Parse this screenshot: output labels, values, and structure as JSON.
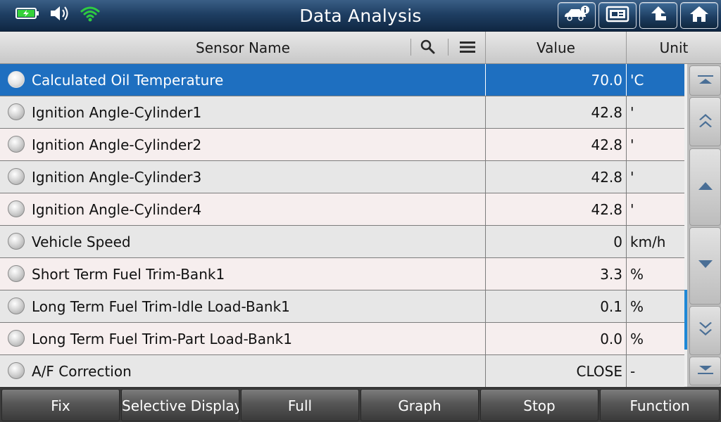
{
  "app": {
    "title": "Data Analysis",
    "status_icons": [
      "battery-charging-icon",
      "speaker-icon",
      "wifi-icon"
    ],
    "top_buttons": [
      "vehicle-info-icon",
      "print-screen-icon",
      "back-up-icon",
      "home-icon"
    ]
  },
  "colors": {
    "selected_row": "#1e6fc0",
    "wifi": "#2ecc40",
    "battery": "#36d13a",
    "scroll_indicator": "#1e88d6"
  },
  "table": {
    "headers": {
      "name": "Sensor Name",
      "value": "Value",
      "unit": "Unit"
    },
    "header_icons": [
      "search-icon",
      "menu-icon"
    ],
    "rows": [
      {
        "name": "Calculated Oil Temperature",
        "value": "70.0",
        "unit": "'C",
        "selected": true
      },
      {
        "name": "Ignition Angle-Cylinder1",
        "value": "42.8",
        "unit": "'"
      },
      {
        "name": "Ignition Angle-Cylinder2",
        "value": "42.8",
        "unit": "'"
      },
      {
        "name": "Ignition Angle-Cylinder3",
        "value": "42.8",
        "unit": "'"
      },
      {
        "name": "Ignition Angle-Cylinder4",
        "value": "42.8",
        "unit": "'"
      },
      {
        "name": "Vehicle Speed",
        "value": "0",
        "unit": "km/h"
      },
      {
        "name": "Short Term Fuel Trim-Bank1",
        "value": "3.3",
        "unit": "%"
      },
      {
        "name": "Long Term Fuel Trim-Idle Load-Bank1",
        "value": "0.1",
        "unit": "%"
      },
      {
        "name": "Long Term Fuel Trim-Part Load-Bank1",
        "value": "0.0",
        "unit": "%"
      },
      {
        "name": "A/F Correction",
        "value": "CLOSE",
        "unit": "-"
      }
    ]
  },
  "scroll_buttons": [
    "scroll-top-icon",
    "page-up-icon",
    "scroll-up-icon",
    "scroll-down-icon",
    "page-down-icon",
    "scroll-bottom-icon"
  ],
  "list_progress": {
    "visible_start_fraction": 0.7,
    "visible_end_fraction": 0.885
  },
  "bottom_buttons": [
    {
      "label": "Fix"
    },
    {
      "label": "Selective Display"
    },
    {
      "label": "Full"
    },
    {
      "label": "Graph"
    },
    {
      "label": "Stop"
    },
    {
      "label": "Function"
    }
  ]
}
